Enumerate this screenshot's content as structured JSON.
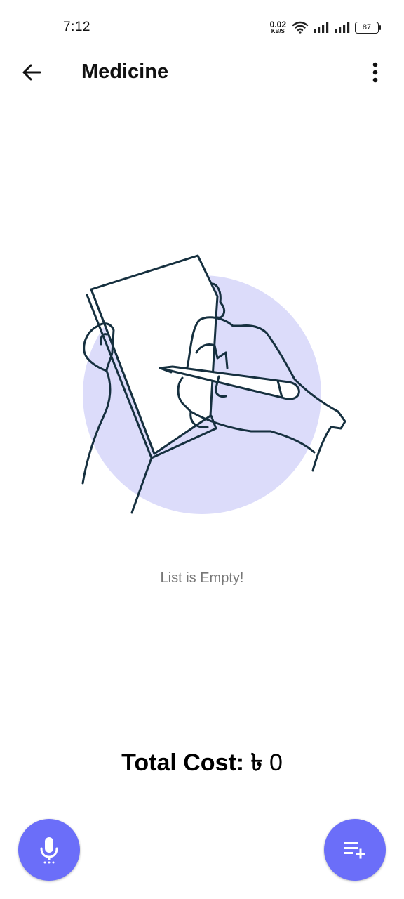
{
  "status_bar": {
    "time": "7:12",
    "net_speed_value": "0.02",
    "net_speed_unit": "KB/S",
    "battery": "87",
    "icons": [
      "wifi-icon",
      "signal-icon",
      "signal-icon",
      "battery-icon"
    ]
  },
  "app_bar": {
    "title": "Medicine",
    "back_icon": "arrow-left-icon",
    "menu_icon": "more-vert-icon"
  },
  "empty_state": {
    "illustration": "hand-writing-notebook-illustration",
    "message": "List is Empty!"
  },
  "summary": {
    "total_label": "Total Cost:",
    "currency": "৳",
    "total_value": "0"
  },
  "fabs": {
    "voice_icon": "mic-icon",
    "add_icon": "playlist-add-icon"
  },
  "colors": {
    "accent": "#6b6ef9",
    "illustration_circle": "#dcdcfa",
    "line_art": "#16303f"
  }
}
